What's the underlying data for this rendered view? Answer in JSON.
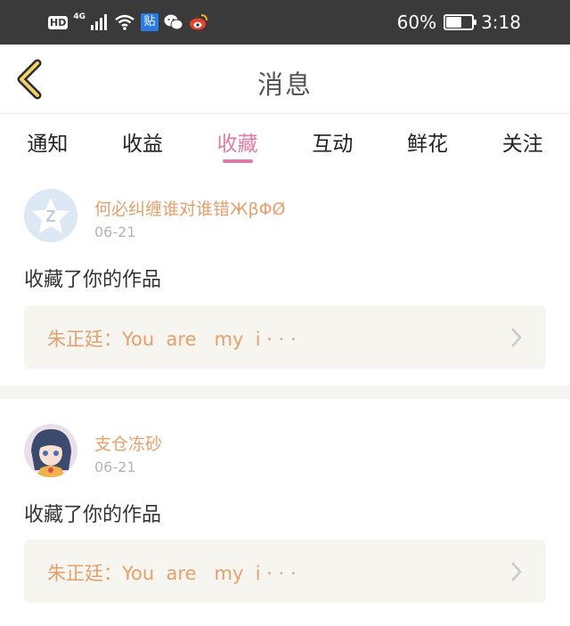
{
  "status_bar": {
    "hd": "HD",
    "network": "4G",
    "tie_label": "贴",
    "battery": "60%",
    "battery_level": 0.6,
    "time": "3:18"
  },
  "header": {
    "title": "消息"
  },
  "tabs": [
    {
      "label": "通知",
      "active": false
    },
    {
      "label": "收益",
      "active": false
    },
    {
      "label": "收藏",
      "active": true
    },
    {
      "label": "互动",
      "active": false
    },
    {
      "label": "鲜花",
      "active": false
    },
    {
      "label": "关注",
      "active": false
    }
  ],
  "notifications": [
    {
      "username": "何必纠缠谁对谁错ЖβΦØ",
      "date": "06-21",
      "action": "收藏了你的作品",
      "work": "朱正廷：You  are   my  i · · ·"
    },
    {
      "username": "支仓冻砂",
      "date": "06-21",
      "action": "收藏了你的作品",
      "work": "朱正廷：You  are   my  i · · ·"
    }
  ],
  "colors": {
    "accent": "#e27aa6",
    "username": "#e5a06c",
    "work_bg": "#f6f5ef",
    "status_bar": "#3a3a3a"
  }
}
